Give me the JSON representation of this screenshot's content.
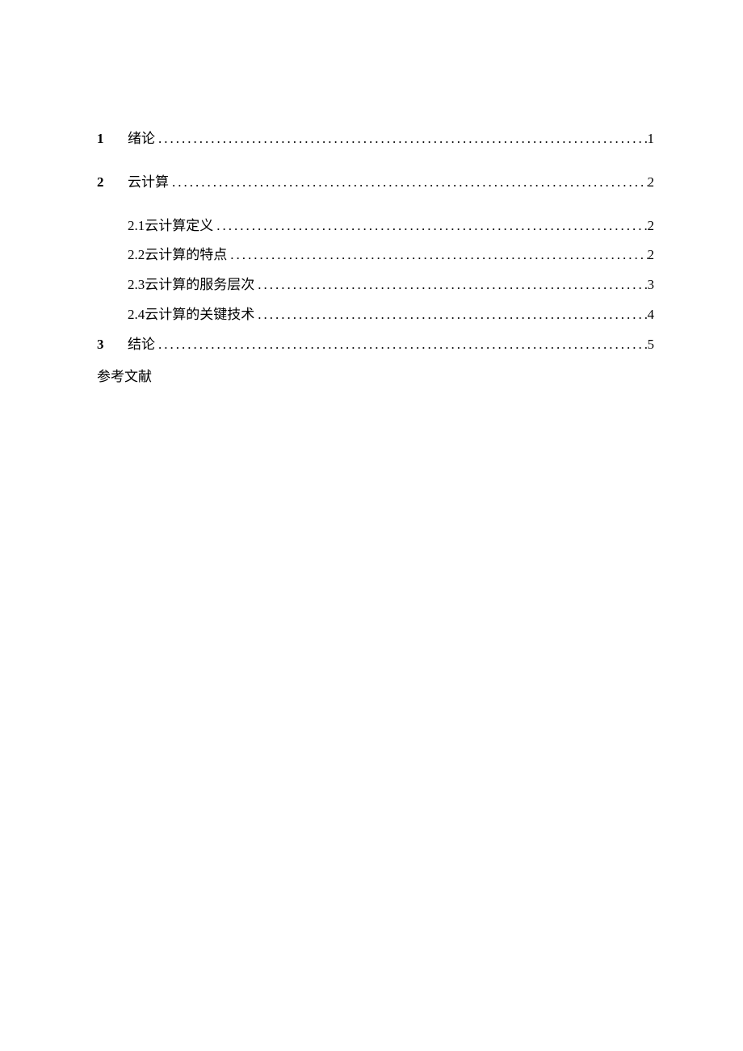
{
  "toc": {
    "entries": [
      {
        "level": 1,
        "number": "1",
        "title": "绪论",
        "page": "1"
      },
      {
        "level": 1,
        "number": "2",
        "title": "云计算",
        "page": "2"
      },
      {
        "level": 2,
        "number": "2.1",
        "title": "云计算定义",
        "page": "2"
      },
      {
        "level": 2,
        "number": "2.2",
        "title": "云计算的特点",
        "page": "2"
      },
      {
        "level": 2,
        "number": "2.3",
        "title": "云计算的服务层次",
        "page": "3"
      },
      {
        "level": 2,
        "number": "2.4",
        "title": "云计算的关键技术",
        "page": "4"
      },
      {
        "level": 1,
        "number": "3",
        "title": "结论",
        "page": "5"
      }
    ],
    "references_label": "参考文献"
  }
}
